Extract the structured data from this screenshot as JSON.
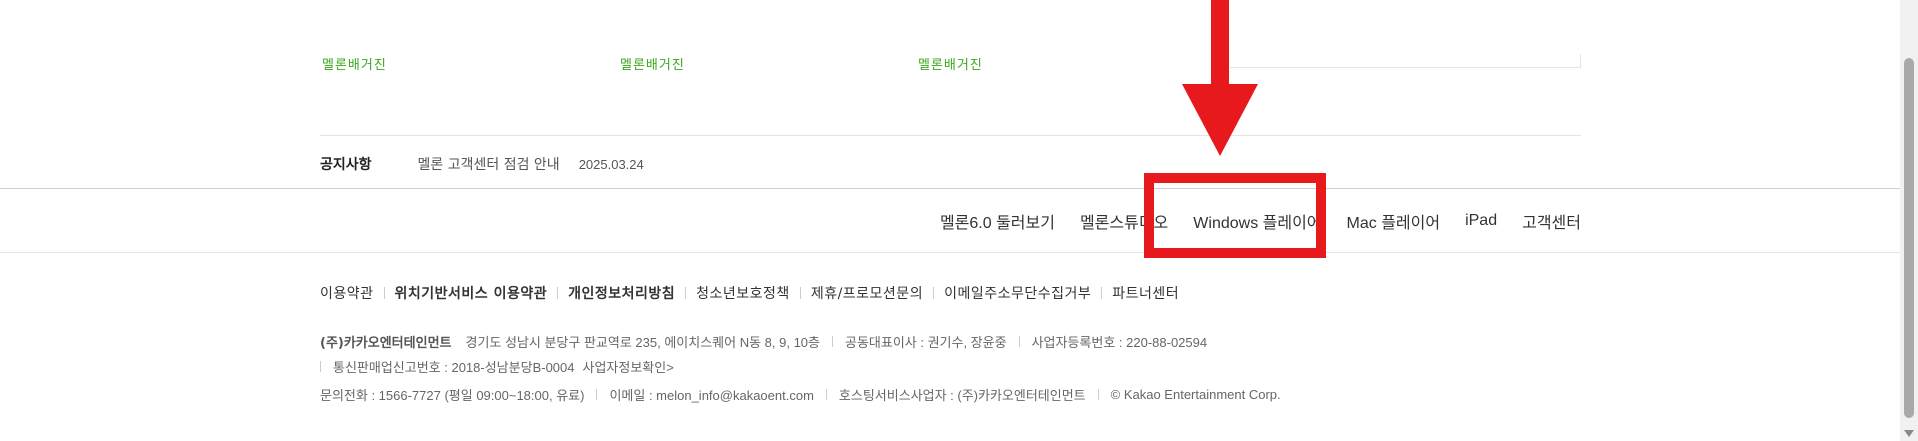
{
  "top_links": [
    "멜론배거진",
    "멜론배거진",
    "멜론배거진"
  ],
  "notice": {
    "title": "공지사항",
    "text": "멜론 고객센터 점검 안내",
    "date": "2025.03.24"
  },
  "footer_menu": [
    "멜론6.0 둘러보기",
    "멜론스튜디오",
    "Windows 플레이어",
    "Mac 플레이어",
    "iPad",
    "고객센터"
  ],
  "policy_links": [
    {
      "label": "이용약관",
      "bold": false
    },
    {
      "label": "위치기반서비스 이용약관",
      "bold": true
    },
    {
      "label": "개인정보처리방침",
      "bold": true
    },
    {
      "label": "청소년보호정책",
      "bold": false
    },
    {
      "label": "제휴/프로모션문의",
      "bold": false
    },
    {
      "label": "이메일주소무단수집거부",
      "bold": false
    },
    {
      "label": "파트너센터",
      "bold": false
    }
  ],
  "company": {
    "name": "(주)카카오엔터테인먼트",
    "address": "경기도 성남시 분당구 판교역로 235, 에이치스퀘어 N동 8, 9, 10층",
    "ceo": "공동대표이사 : 권기수, 장윤중",
    "biz_no": "사업자등록번호 : 220-88-02594",
    "mail_order_no": "통신판매업신고번호 : 2018-성남분당B-0004",
    "biz_info_link": "사업자정보확인>",
    "phone": "문의전화 : 1566-7727 (평일 09:00~18:00, 유료)",
    "email": "이메일 : melon_info@kakaoent.com",
    "hosting": "호스팅서비스사업자 : (주)카카오엔터테인먼트",
    "copyright": "© Kakao Entertainment Corp."
  },
  "colors": {
    "annotation_red": "#e8191d",
    "link_green": "#3aa81a"
  }
}
